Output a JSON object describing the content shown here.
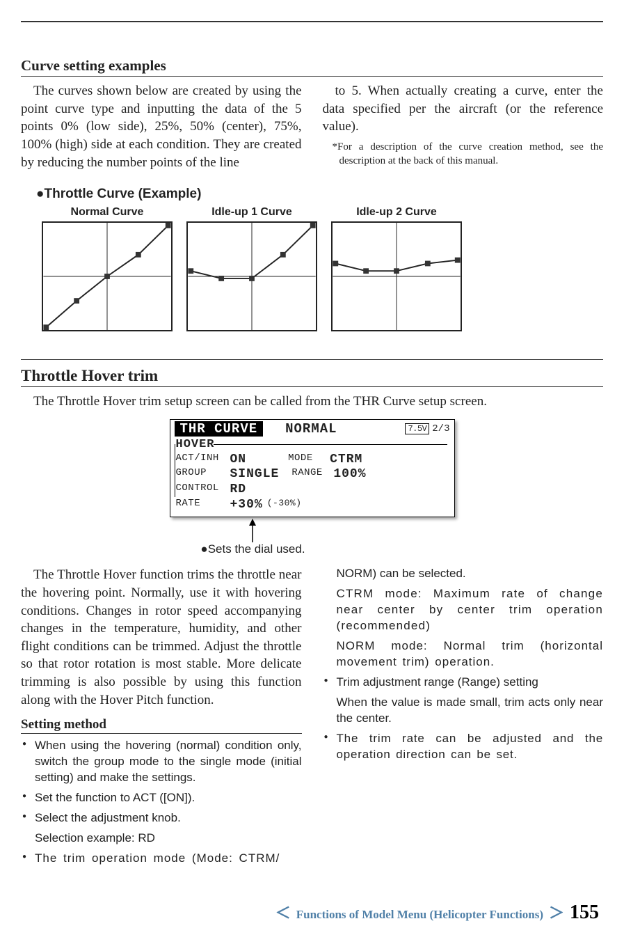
{
  "section1": {
    "title": "Curve setting examples",
    "para_l": "The curves shown below are created by using the point curve type and inputting the data of the 5 points 0% (low side), 25%, 50% (center), 75%, 100% (high) side at each condition. They are created by reducing the number points of the line",
    "para_r": "to 5. When actually creating a curve, enter the data specified per the aircraft (or the reference value).",
    "footnote": "*For a description of the curve creation method, see the description at the back of this manual."
  },
  "curves": {
    "header": "●Throttle Curve (Example)",
    "labels": {
      "normal": "Normal Curve",
      "idle1": "Idle-up 1 Curve",
      "idle2": "Idle-up 2 Curve"
    }
  },
  "chart_data": [
    {
      "type": "line",
      "name": "Normal Curve",
      "x": [
        0,
        25,
        50,
        75,
        100
      ],
      "y": [
        0,
        25,
        50,
        70,
        100
      ],
      "xlim": [
        0,
        100
      ],
      "ylim": [
        0,
        100
      ]
    },
    {
      "type": "line",
      "name": "Idle-up 1 Curve",
      "x": [
        0,
        25,
        50,
        75,
        100
      ],
      "y": [
        55,
        48,
        48,
        70,
        100
      ],
      "xlim": [
        0,
        100
      ],
      "ylim": [
        0,
        100
      ]
    },
    {
      "type": "line",
      "name": "Idle-up 2 Curve",
      "x": [
        0,
        25,
        50,
        75,
        100
      ],
      "y": [
        62,
        55,
        55,
        62,
        65
      ],
      "xlim": [
        0,
        100
      ],
      "ylim": [
        0,
        100
      ]
    }
  ],
  "section2": {
    "title": "Throttle Hover trim",
    "intro": "The Throttle Hover trim setup screen can be called from the THR Curve setup screen."
  },
  "lcd": {
    "title": "THR CURVE",
    "condition": "NORMAL",
    "battery": "7.5V",
    "page": "2/3",
    "group_header": "HOVER",
    "rows": {
      "act_inh_lbl": "ACT/INH",
      "act_inh_val": "ON",
      "mode_lbl": "MODE",
      "mode_val": "CTRM",
      "group_lbl": "GROUP",
      "group_val": "SINGLE",
      "range_lbl": "RANGE",
      "range_val": "100%",
      "control_lbl": "CONTROL",
      "control_val": "RD",
      "rate_lbl": "RATE",
      "rate_val": "+30%",
      "rate_sub": "(-30%)"
    },
    "arrow_note": "●Sets the dial used."
  },
  "hover": {
    "para": "The Throttle Hover function trims the throttle near the hovering point. Normally, use it with hovering conditions. Changes in rotor speed accompanying changes in the temperature, humidity, and other flight conditions can be trimmed. Adjust the throttle so that rotor rotation is most stable. More delicate trimming is also possible by using this function along with the Hover Pitch function.",
    "setting_title": "Setting method",
    "bullets_l": [
      "When using the hovering (normal) condition only, switch the group mode to the single mode (initial setting) and make the settings.",
      "Set the function to ACT ([ON]).",
      "Select the adjustment knob."
    ],
    "sub_l": "Selection example: RD",
    "bullet_l_last": "The trim operation mode (Mode: CTRM/",
    "col_r_cont": "NORM) can be selected.",
    "ctrm_text": "CTRM mode: Maximum rate of change near center by center trim operation (recommended)",
    "norm_text": "NORM mode: Normal trim (horizontal movement trim) operation.",
    "bullets_r": [
      "Trim adjustment range (Range) setting"
    ],
    "sub_r": "When the value is made small, trim acts only near the center.",
    "bullet_r_last": "The trim rate can be adjusted and the operation direction can be set."
  },
  "footer": {
    "chapter": "Functions of Model Menu (Helicopter Functions)",
    "page": "155"
  }
}
